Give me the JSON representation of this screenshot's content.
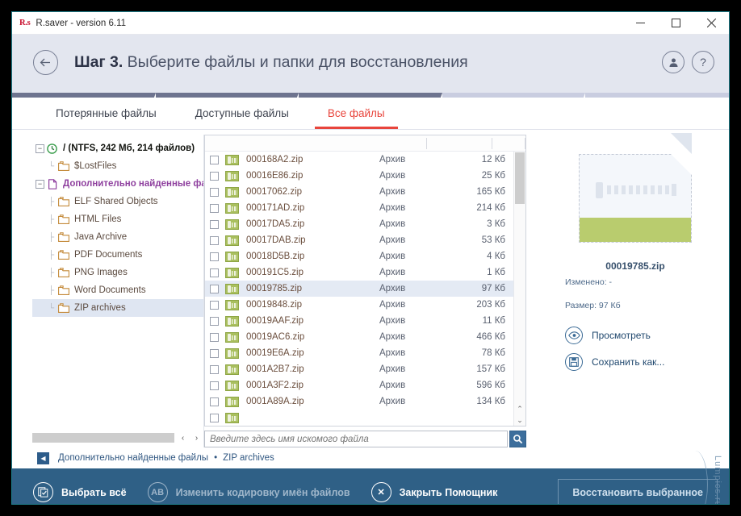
{
  "window": {
    "app_mark": "R.s",
    "title": "R.saver - version 6.11",
    "minimize": "–",
    "maximize": "□",
    "close": "✕"
  },
  "header": {
    "step_label": "Шаг 3.",
    "title": "Выберите файлы и папки для восстановления",
    "back_icon": "arrow-left",
    "user_icon": "user",
    "help_icon": "question-mark",
    "stepper": {
      "total": 5,
      "completed": 3
    }
  },
  "tabs": [
    {
      "label": "Потерянные файлы",
      "active": false
    },
    {
      "label": "Доступные файлы",
      "active": false
    },
    {
      "label": "Все файлы",
      "active": true
    }
  ],
  "tree": {
    "nodes": [
      {
        "label": "/ (NTFS, 242 Мб, 214 файлов)",
        "level": 0,
        "style": "root",
        "expander": "−",
        "icon": "clock-icon",
        "selected": false
      },
      {
        "label": "$LostFiles",
        "level": 1,
        "style": "normal",
        "expander": "",
        "icon": "folder-icon",
        "selected": false
      },
      {
        "label": "Дополнительно найденные файлы",
        "level": 0,
        "style": "purple",
        "expander": "−",
        "icon": "document-icon",
        "selected": false
      },
      {
        "label": "ELF Shared Objects",
        "level": 1,
        "style": "normal",
        "expander": "",
        "icon": "folder-icon",
        "selected": false
      },
      {
        "label": "HTML Files",
        "level": 1,
        "style": "normal",
        "expander": "",
        "icon": "folder-icon",
        "selected": false
      },
      {
        "label": "Java Archive",
        "level": 1,
        "style": "normal",
        "expander": "",
        "icon": "folder-icon",
        "selected": false
      },
      {
        "label": "PDF Documents",
        "level": 1,
        "style": "normal",
        "expander": "",
        "icon": "folder-icon",
        "selected": false
      },
      {
        "label": "PNG Images",
        "level": 1,
        "style": "normal",
        "expander": "",
        "icon": "folder-icon",
        "selected": false
      },
      {
        "label": "Word Documents",
        "level": 1,
        "style": "normal",
        "expander": "",
        "icon": "folder-icon",
        "selected": false
      },
      {
        "label": "ZIP archives",
        "level": 1,
        "style": "normal",
        "expander": "",
        "icon": "folder-icon",
        "selected": true
      }
    ],
    "hscroll_left": "‹",
    "hscroll_right": "›"
  },
  "file_list": {
    "rows": [
      {
        "name": "000168A2.zip",
        "type": "Архив",
        "size": "12 Кб",
        "checked": false,
        "selected": false
      },
      {
        "name": "00016E86.zip",
        "type": "Архив",
        "size": "25 Кб",
        "checked": false,
        "selected": false
      },
      {
        "name": "00017062.zip",
        "type": "Архив",
        "size": "165 Кб",
        "checked": false,
        "selected": false
      },
      {
        "name": "000171AD.zip",
        "type": "Архив",
        "size": "214 Кб",
        "checked": false,
        "selected": false
      },
      {
        "name": "00017DA5.zip",
        "type": "Архив",
        "size": "3 Кб",
        "checked": false,
        "selected": false
      },
      {
        "name": "00017DAB.zip",
        "type": "Архив",
        "size": "53 Кб",
        "checked": false,
        "selected": false
      },
      {
        "name": "00018D5B.zip",
        "type": "Архив",
        "size": "4 Кб",
        "checked": false,
        "selected": false
      },
      {
        "name": "000191C5.zip",
        "type": "Архив",
        "size": "1 Кб",
        "checked": false,
        "selected": false
      },
      {
        "name": "00019785.zip",
        "type": "Архив",
        "size": "97 Кб",
        "checked": false,
        "selected": true
      },
      {
        "name": "00019848.zip",
        "type": "Архив",
        "size": "203 Кб",
        "checked": false,
        "selected": false
      },
      {
        "name": "00019AAF.zip",
        "type": "Архив",
        "size": "11 Кб",
        "checked": false,
        "selected": false
      },
      {
        "name": "00019AC6.zip",
        "type": "Архив",
        "size": "466 Кб",
        "checked": false,
        "selected": false
      },
      {
        "name": "00019E6A.zip",
        "type": "Архив",
        "size": "78 Кб",
        "checked": false,
        "selected": false
      },
      {
        "name": "0001A2B7.zip",
        "type": "Архив",
        "size": "157 Кб",
        "checked": false,
        "selected": false
      },
      {
        "name": "0001A3F2.zip",
        "type": "Архив",
        "size": "596 Кб",
        "checked": false,
        "selected": false
      },
      {
        "name": "0001A89A.zip",
        "type": "Архив",
        "size": "134 Кб",
        "checked": false,
        "selected": false
      }
    ],
    "scroll_up": "⌃",
    "scroll_down": "⌄"
  },
  "search": {
    "value": "",
    "placeholder": "Введите здесь имя искомого файла",
    "button_icon": "search-icon"
  },
  "preview": {
    "file_name": "00019785.zip",
    "modified_label": "Изменено: -",
    "size_label": "Размер: 97 Кб",
    "view_action": "Просмотреть",
    "save_action": "Сохранить как...",
    "thumb_icon": "zip-archive-thumbnail"
  },
  "breadcrumb": {
    "back_icon": "◀",
    "items": [
      "Дополнительно найденные файлы",
      "ZIP archives"
    ],
    "separator": "•"
  },
  "footer": {
    "select_all": "Выбрать всё",
    "select_all_icon": "checkbox-list-icon",
    "encoding": "Изменить кодировку имён файлов",
    "encoding_icon": "AB",
    "close_assistant": "Закрыть Помощник",
    "close_assistant_icon": "✕",
    "restore_button": "Восстановить выбранное",
    "watermark": "Lumpics.ru"
  },
  "colors": {
    "accent_red": "#e8453c",
    "footer_blue": "#2f6086",
    "header_grey": "#e3e6ef",
    "zip_green": "#a9bf5e",
    "border_teal": "#1f7f8c"
  }
}
